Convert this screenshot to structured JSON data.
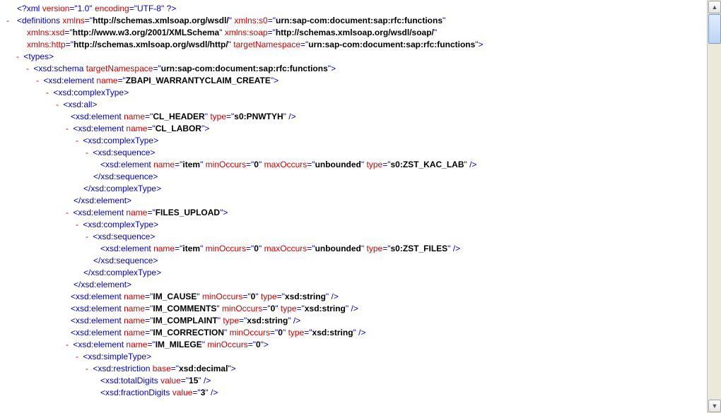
{
  "xml_decl": {
    "version": "1.0",
    "encoding": "UTF-8"
  },
  "definitions": {
    "xmlns": "http://schemas.xmlsoap.org/wsdl/",
    "xmlns_s0": "urn:sap-com:document:sap:rfc:functions",
    "xmlns_xsd": "http://www.w3.org/2001/XMLSchema",
    "xmlns_soap": "http://schemas.xmlsoap.org/wsdl/soap/",
    "xmlns_http": "http://schemas.xmlsoap.org/wsdl/http/",
    "targetNamespace": "urn:sap-com:document:sap:rfc:functions"
  },
  "types": {
    "schema_targetNamespace": "urn:sap-com:document:sap:rfc:functions",
    "element_name": "ZBAPI_WARRANTYCLAIM_CREATE",
    "cl_header": {
      "name": "CL_HEADER",
      "type": "s0:PNWTYH"
    },
    "cl_labor": {
      "name": "CL_LABOR",
      "item": {
        "name": "item",
        "minOccurs": "0",
        "maxOccurs": "unbounded",
        "type": "s0:ZST_KAC_LAB"
      }
    },
    "files_upload": {
      "name": "FILES_UPLOAD",
      "item": {
        "name": "item",
        "minOccurs": "0",
        "maxOccurs": "unbounded",
        "type": "s0:ZST_FILES"
      }
    },
    "im_cause": {
      "name": "IM_CAUSE",
      "minOccurs": "0",
      "type": "xsd:string"
    },
    "im_comments": {
      "name": "IM_COMMENTS",
      "minOccurs": "0",
      "type": "xsd:string"
    },
    "im_complaint": {
      "name": "IM_COMPLAINT",
      "type": "xsd:string"
    },
    "im_correction": {
      "name": "IM_CORRECTION",
      "minOccurs": "0",
      "type": "xsd:string"
    },
    "im_milege": {
      "name": "IM_MILEGE",
      "minOccurs": "0"
    },
    "restriction": {
      "base": "xsd:decimal",
      "totalDigits": "15",
      "fractionDigits": "3"
    }
  },
  "labels": {
    "xml": "xml",
    "version": "version",
    "encoding": "encoding",
    "definitions": "definitions",
    "xmlns": "xmlns",
    "xmlns_s0": "xmlns:s0",
    "xmlns_xsd": "xmlns:xsd",
    "xmlns_soap": "xmlns:soap",
    "xmlns_http": "xmlns:http",
    "targetNamespace": "targetNamespace",
    "types": "types",
    "xsd_schema": "xsd:schema",
    "xsd_element": "xsd:element",
    "xsd_complexType": "xsd:complexType",
    "xsd_all": "xsd:all",
    "xsd_sequence": "xsd:sequence",
    "xsd_simpleType": "xsd:simpleType",
    "xsd_restriction": "xsd:restriction",
    "xsd_totalDigits": "xsd:totalDigits",
    "xsd_fractionDigits": "xsd:fractionDigits",
    "name": "name",
    "type": "type",
    "minOccurs": "minOccurs",
    "maxOccurs": "maxOccurs",
    "base": "base",
    "value": "value"
  }
}
